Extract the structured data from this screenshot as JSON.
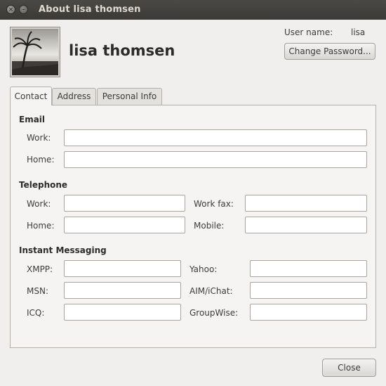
{
  "window": {
    "title": "About lisa thomsen"
  },
  "header": {
    "full_name": "lisa thomsen",
    "username_label": "User name:",
    "username_value": "lisa",
    "change_password_label": "Change Password..."
  },
  "tabs": [
    {
      "label": "Contact",
      "active": true
    },
    {
      "label": "Address",
      "active": false
    },
    {
      "label": "Personal Info",
      "active": false
    }
  ],
  "email": {
    "heading": "Email",
    "work_label": "Work:",
    "work_value": "",
    "home_label": "Home:",
    "home_value": ""
  },
  "telephone": {
    "heading": "Telephone",
    "work_label": "Work:",
    "work_value": "",
    "work_fax_label": "Work fax:",
    "work_fax_value": "",
    "home_label": "Home:",
    "home_value": "",
    "mobile_label": "Mobile:",
    "mobile_value": ""
  },
  "im": {
    "heading": "Instant Messaging",
    "xmpp_label": "XMPP:",
    "xmpp_value": "",
    "yahoo_label": "Yahoo:",
    "yahoo_value": "",
    "msn_label": "MSN:",
    "msn_value": "",
    "aim_label": "AIM/iChat:",
    "aim_value": "",
    "icq_label": "ICQ:",
    "icq_value": "",
    "groupwise_label": "GroupWise:",
    "groupwise_value": ""
  },
  "footer": {
    "close_label": "Close"
  },
  "icons": {
    "close": "close-icon",
    "minimize": "minimize-icon",
    "avatar": "beach-sunset-photo"
  }
}
